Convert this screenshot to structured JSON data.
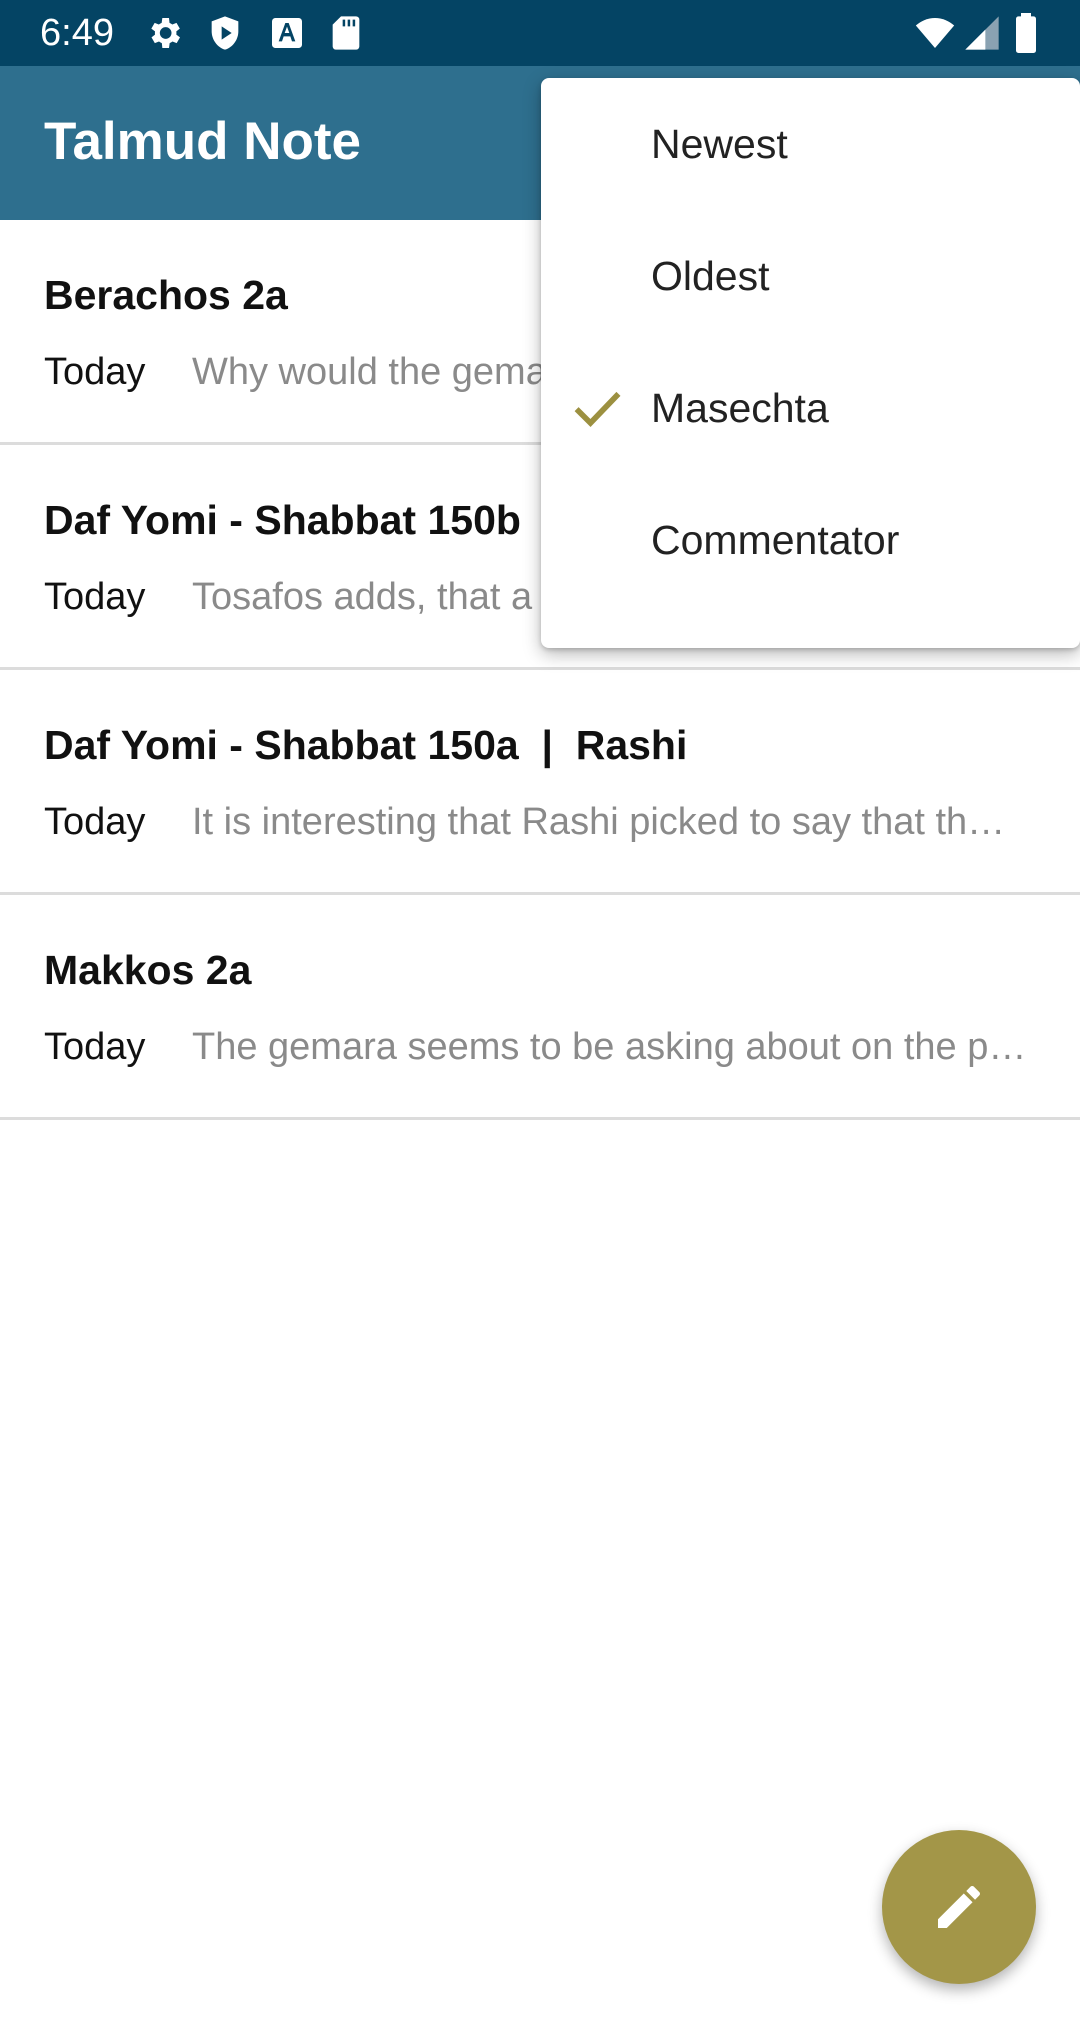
{
  "status_bar": {
    "time": "6:49",
    "left_icons": [
      "gear-icon",
      "shield-play-icon",
      "font-a-icon",
      "sd-card-icon"
    ],
    "right_icons": [
      "wifi-icon",
      "cell-signal-icon",
      "battery-icon"
    ]
  },
  "app_bar": {
    "title": "Talmud Note"
  },
  "notes": [
    {
      "title": "Berachos 2a",
      "date": "Today",
      "preview": "Why would the gemara"
    },
    {
      "title": "Daf Yomi - Shabbat 150b",
      "date": "Today",
      "preview": "Tosafos adds, that a"
    },
    {
      "title": "Daf Yomi - Shabbat 150a  |  Rashi",
      "date": "Today",
      "preview": "It is interesting that Rashi picked to say that th…"
    },
    {
      "title": "Makkos 2a",
      "date": "Today",
      "preview": "The gemara seems to be asking about on the p…"
    }
  ],
  "sort_menu": {
    "items": [
      {
        "label": "Newest",
        "checked": false
      },
      {
        "label": "Oldest",
        "checked": false
      },
      {
        "label": "Masechta",
        "checked": true
      },
      {
        "label": "Commentator",
        "checked": false
      }
    ]
  },
  "fab": {
    "icon": "pencil-icon"
  },
  "colors": {
    "status_bar": "#044464",
    "app_bar": "#2e6f8e",
    "accent": "#a39648",
    "check": "#9c9040"
  }
}
